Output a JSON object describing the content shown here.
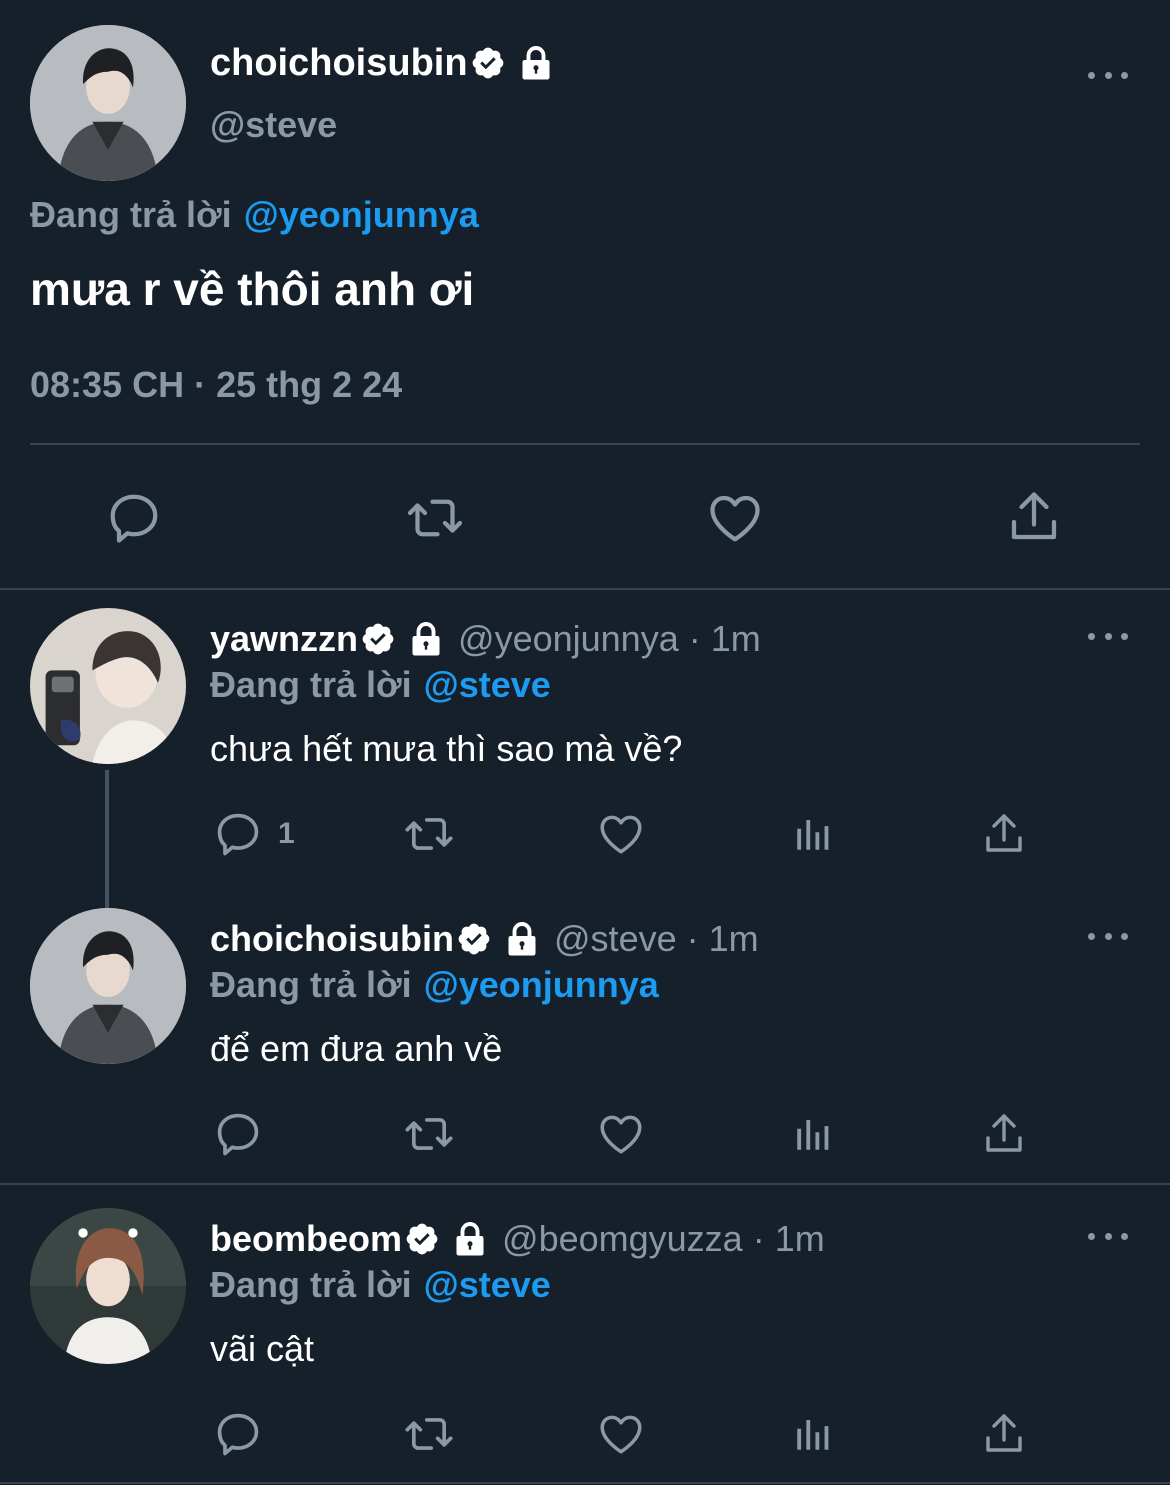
{
  "main_tweet": {
    "display_name": "choichoisubin",
    "handle": "@steve",
    "replying_prefix": "Đang trả lời",
    "replying_to": "@yeonjunnya",
    "text": "mưa r về thôi anh ơi",
    "timestamp": "08:35 CH · 25 thg 2 24",
    "icons": [
      "reply-icon",
      "retweet-icon",
      "like-icon",
      "share-icon"
    ]
  },
  "replies": [
    {
      "display_name": "yawnzzn",
      "handle": "@yeonjunnya",
      "time": "· 1m",
      "replying_prefix": "Đang trả lời",
      "replying_to": "@steve",
      "text": "chưa hết mưa thì sao mà về?",
      "reply_count": "1"
    },
    {
      "display_name": "choichoisubin",
      "handle": "@steve",
      "time": "· 1m",
      "replying_prefix": "Đang trả lời",
      "replying_to": "@yeonjunnya",
      "text": "để em đưa anh về",
      "reply_count": ""
    },
    {
      "display_name": "beombeom",
      "handle": "@beomgyuzza",
      "time": "· 1m",
      "replying_prefix": "Đang trả lời",
      "replying_to": "@steve",
      "text": "vãi cật",
      "reply_count": ""
    }
  ],
  "colors": {
    "background": "#15202b",
    "muted": "#8b98a5",
    "link": "#1d9bf0",
    "divider": "#38444d"
  }
}
